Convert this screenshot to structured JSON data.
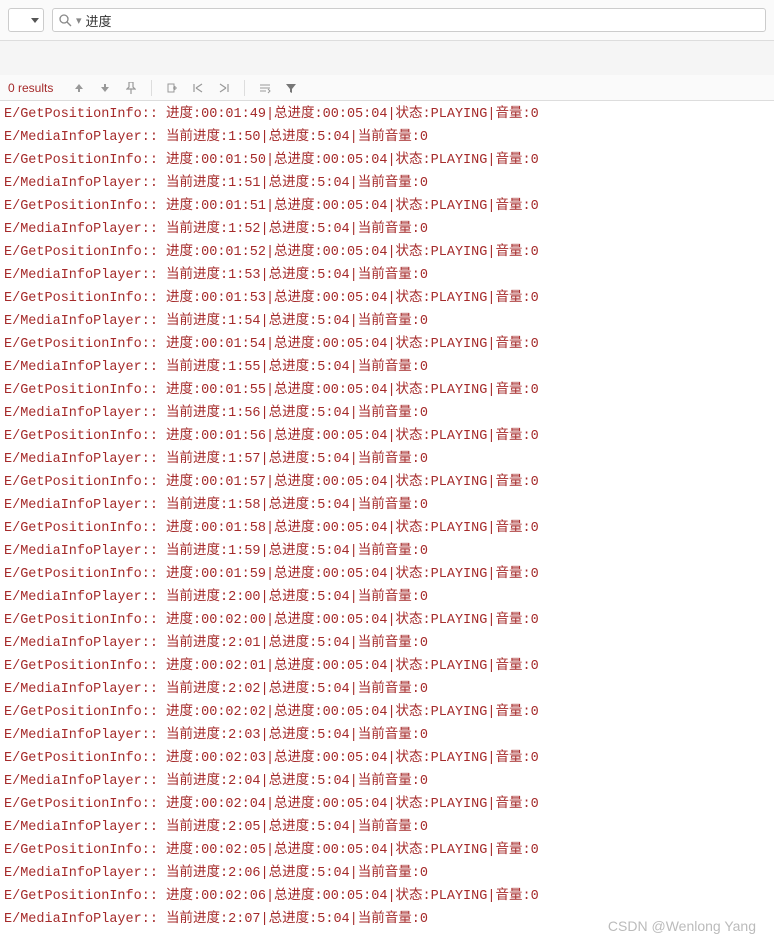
{
  "search": {
    "value": "进度"
  },
  "results_label": "0 results",
  "watermark": "CSDN @Wenlong Yang",
  "log_lines": [
    "E/GetPositionInfo:: 进度:00:01:49|总进度:00:05:04|状态:PLAYING|音量:0",
    "E/MediaInfoPlayer:: 当前进度:1:50|总进度:5:04|当前音量:0",
    "E/GetPositionInfo:: 进度:00:01:50|总进度:00:05:04|状态:PLAYING|音量:0",
    "E/MediaInfoPlayer:: 当前进度:1:51|总进度:5:04|当前音量:0",
    "E/GetPositionInfo:: 进度:00:01:51|总进度:00:05:04|状态:PLAYING|音量:0",
    "E/MediaInfoPlayer:: 当前进度:1:52|总进度:5:04|当前音量:0",
    "E/GetPositionInfo:: 进度:00:01:52|总进度:00:05:04|状态:PLAYING|音量:0",
    "E/MediaInfoPlayer:: 当前进度:1:53|总进度:5:04|当前音量:0",
    "E/GetPositionInfo:: 进度:00:01:53|总进度:00:05:04|状态:PLAYING|音量:0",
    "E/MediaInfoPlayer:: 当前进度:1:54|总进度:5:04|当前音量:0",
    "E/GetPositionInfo:: 进度:00:01:54|总进度:00:05:04|状态:PLAYING|音量:0",
    "E/MediaInfoPlayer:: 当前进度:1:55|总进度:5:04|当前音量:0",
    "E/GetPositionInfo:: 进度:00:01:55|总进度:00:05:04|状态:PLAYING|音量:0",
    "E/MediaInfoPlayer:: 当前进度:1:56|总进度:5:04|当前音量:0",
    "E/GetPositionInfo:: 进度:00:01:56|总进度:00:05:04|状态:PLAYING|音量:0",
    "E/MediaInfoPlayer:: 当前进度:1:57|总进度:5:04|当前音量:0",
    "E/GetPositionInfo:: 进度:00:01:57|总进度:00:05:04|状态:PLAYING|音量:0",
    "E/MediaInfoPlayer:: 当前进度:1:58|总进度:5:04|当前音量:0",
    "E/GetPositionInfo:: 进度:00:01:58|总进度:00:05:04|状态:PLAYING|音量:0",
    "E/MediaInfoPlayer:: 当前进度:1:59|总进度:5:04|当前音量:0",
    "E/GetPositionInfo:: 进度:00:01:59|总进度:00:05:04|状态:PLAYING|音量:0",
    "E/MediaInfoPlayer:: 当前进度:2:00|总进度:5:04|当前音量:0",
    "E/GetPositionInfo:: 进度:00:02:00|总进度:00:05:04|状态:PLAYING|音量:0",
    "E/MediaInfoPlayer:: 当前进度:2:01|总进度:5:04|当前音量:0",
    "E/GetPositionInfo:: 进度:00:02:01|总进度:00:05:04|状态:PLAYING|音量:0",
    "E/MediaInfoPlayer:: 当前进度:2:02|总进度:5:04|当前音量:0",
    "E/GetPositionInfo:: 进度:00:02:02|总进度:00:05:04|状态:PLAYING|音量:0",
    "E/MediaInfoPlayer:: 当前进度:2:03|总进度:5:04|当前音量:0",
    "E/GetPositionInfo:: 进度:00:02:03|总进度:00:05:04|状态:PLAYING|音量:0",
    "E/MediaInfoPlayer:: 当前进度:2:04|总进度:5:04|当前音量:0",
    "E/GetPositionInfo:: 进度:00:02:04|总进度:00:05:04|状态:PLAYING|音量:0",
    "E/MediaInfoPlayer:: 当前进度:2:05|总进度:5:04|当前音量:0",
    "E/GetPositionInfo:: 进度:00:02:05|总进度:00:05:04|状态:PLAYING|音量:0",
    "E/MediaInfoPlayer:: 当前进度:2:06|总进度:5:04|当前音量:0",
    "E/GetPositionInfo:: 进度:00:02:06|总进度:00:05:04|状态:PLAYING|音量:0",
    "E/MediaInfoPlayer:: 当前进度:2:07|总进度:5:04|当前音量:0"
  ]
}
